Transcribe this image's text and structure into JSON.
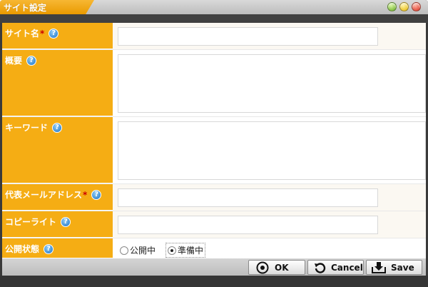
{
  "window": {
    "title": "サイト設定"
  },
  "form": {
    "rows": [
      {
        "label": "サイト名",
        "required": "*",
        "value": ""
      },
      {
        "label": "概要",
        "value": ""
      },
      {
        "label": "キーワード",
        "value": ""
      },
      {
        "label": "代表メールアドレス",
        "required": "*",
        "value": ""
      },
      {
        "label": "コピーライト",
        "value": ""
      },
      {
        "label": "公開状態"
      }
    ],
    "status_options": [
      {
        "label": "公開中",
        "selected": false
      },
      {
        "label": "準備中",
        "selected": true
      }
    ]
  },
  "footer": {
    "ok_label": "OK",
    "cancel_label": "Cancel",
    "save_label": "Save"
  },
  "colors": {
    "label_bg": "#f5ad14",
    "title_tab": "#f0a820",
    "required": "#cc0000",
    "help_icon": "#1b72c5"
  },
  "icons": {
    "help": "question-circle-icon",
    "ok": "target-circle-icon",
    "cancel": "undo-arrow-icon",
    "save": "download-tray-icon"
  }
}
